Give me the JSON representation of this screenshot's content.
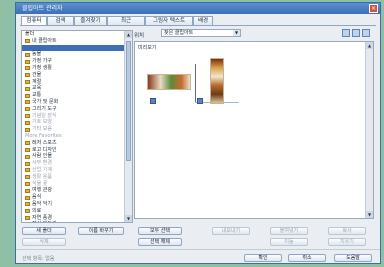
{
  "window": {
    "title": "클립아트 관리자",
    "close_label": "×"
  },
  "tabs": [
    "컴퓨터",
    "검색",
    "즐겨찾기",
    "최근",
    "그림자 텍스트",
    "배경"
  ],
  "left_panel": {
    "items": [
      {
        "label": "폴더",
        "kind": "root"
      },
      {
        "label": "내 클립아트",
        "kind": "folder"
      },
      {
        "label": "",
        "kind": "selected"
      },
      {
        "label": "동물",
        "kind": "folder"
      },
      {
        "label": "가정 가구",
        "kind": "folder"
      },
      {
        "label": "가정 생활",
        "kind": "folder"
      },
      {
        "label": "건물",
        "kind": "folder"
      },
      {
        "label": "계절",
        "kind": "folder"
      },
      {
        "label": "교육",
        "kind": "folder"
      },
      {
        "label": "교통",
        "kind": "folder"
      },
      {
        "label": "국가 및 문화",
        "kind": "folder"
      },
      {
        "label": "그리기 도구",
        "kind": "folder"
      },
      {
        "label": "기념일 장식",
        "kind": "folder-dim"
      },
      {
        "label": "기호 모양",
        "kind": "folder-dim"
      },
      {
        "label": "기타 모음",
        "kind": "folder-dim"
      },
      {
        "label": "More Favorites",
        "kind": "dim"
      },
      {
        "label": "레저 스포츠",
        "kind": "folder"
      },
      {
        "label": "로고 디자인",
        "kind": "folder"
      },
      {
        "label": "사람 인물",
        "kind": "folder"
      },
      {
        "label": "사무 환경",
        "kind": "folder-dim"
      },
      {
        "label": "산업 기계",
        "kind": "folder-dim"
      },
      {
        "label": "생활 용품",
        "kind": "folder-dim"
      },
      {
        "label": "식물 꽃",
        "kind": "folder-dim"
      },
      {
        "label": "여행 관광",
        "kind": "folder"
      },
      {
        "label": "음식",
        "kind": "folder"
      },
      {
        "label": "음악 악기",
        "kind": "folder"
      },
      {
        "label": "의료",
        "kind": "folder"
      },
      {
        "label": "자연 풍경",
        "kind": "folder"
      },
      {
        "label": "장식 테두리",
        "kind": "folder"
      },
      {
        "label": "종교",
        "kind": "folder"
      },
      {
        "label": "직업 인물",
        "kind": "folder"
      },
      {
        "label": "축하 카드",
        "kind": "folder"
      },
      {
        "label": "컴퓨터",
        "kind": "folder"
      },
      {
        "label": "통신 기기",
        "kind": "folder"
      },
      {
        "label": "특수 효과",
        "kind": "folder-dim"
      }
    ],
    "new_folder_button": "새 폴더",
    "rename_button": "이름 바꾸기",
    "delete_button": "삭제"
  },
  "toolbar": {
    "path_label": "위치",
    "path_value": "찾은 클립아트",
    "dropdown_arrow": "▼"
  },
  "right_panel": {
    "title": "미리보기",
    "select_all_button": "모두 선택",
    "clear_button": "선택 해제",
    "actions": [
      "내보내기",
      "붙여넣기",
      "복사",
      "이동",
      "지우기"
    ]
  },
  "footer": {
    "status": "선택 항목: 없음",
    "ok_button": "확인",
    "cancel_button": "취소",
    "help_button": "도움말"
  }
}
